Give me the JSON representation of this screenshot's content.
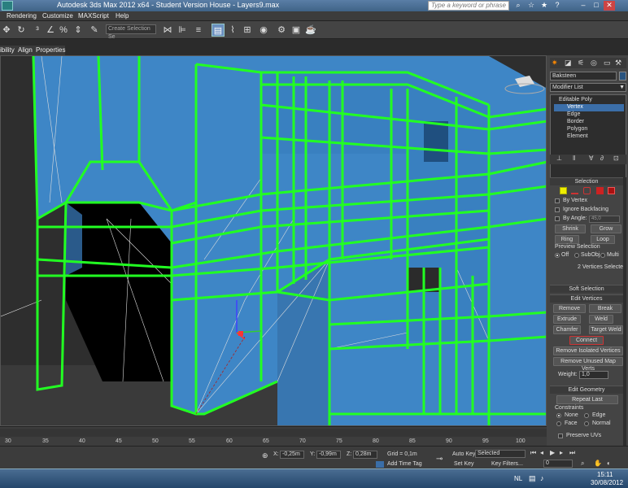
{
  "titlebar": {
    "title": "Autodesk 3ds Max 2012 x64 - Student Version House - Layers9.max",
    "search_placeholder": "Type a keyword or phrase"
  },
  "menu": [
    "Rendering",
    "Customize",
    "MAXScript",
    "Help"
  ],
  "toolbar": {
    "selection_set_placeholder": "Create Selection Se"
  },
  "ribbon": [
    "ibility",
    "Align",
    "Properties"
  ],
  "command_panel": {
    "object_name": "Baksteen",
    "modifier_list": "Modifier List",
    "stack": [
      "Editable Poly",
      "Vertex",
      "Edge",
      "Border",
      "Polygon",
      "Element"
    ],
    "selection": {
      "header": "Selection",
      "by_vertex": "By Vertex",
      "ignore_backfacing": "Ignore Backfacing",
      "by_angle": "By Angle:",
      "angle_value": "45,0",
      "shrink": "Shrink",
      "grow": "Grow",
      "ring": "Ring",
      "loop": "Loop",
      "preview_selection": "Preview Selection",
      "preview_off": "Off",
      "preview_subobj": "SubObj",
      "preview_multi": "Multi",
      "status": "2 Vertices Selected"
    },
    "soft_selection": "Soft Selection",
    "edit_vertices": {
      "header": "Edit Vertices",
      "remove": "Remove",
      "break": "Break",
      "extrude": "Extrude",
      "weld": "Weld",
      "chamfer": "Chamfer",
      "target_weld": "Target Weld",
      "connect": "Connect",
      "remove_isolated": "Remove Isolated Vertices",
      "remove_unused_map": "Remove Unused Map Verts",
      "weight_label": "Weight:",
      "weight_value": "1,0"
    },
    "edit_geometry": {
      "header": "Edit Geometry",
      "repeat_last": "Repeat Last",
      "constraints": "Constraints",
      "none": "None",
      "edge": "Edge",
      "face": "Face",
      "normal": "Normal",
      "preserve_uvs": "Preserve UVs"
    }
  },
  "timeline": {
    "ticks": [
      "30",
      "35",
      "40",
      "45",
      "50",
      "55",
      "60",
      "65",
      "70",
      "75",
      "80",
      "85",
      "90",
      "95",
      "100"
    ]
  },
  "statusbar": {
    "x_label": "X:",
    "x_value": "-0,25m",
    "y_label": "Y:",
    "y_value": "-0,99m",
    "z_label": "Z:",
    "z_value": "0,28m",
    "grid": "Grid = 0,1m",
    "add_time_tag": "Add Time Tag",
    "auto_key": "Auto Key",
    "selected": "Selected",
    "set_key": "Set Key",
    "key_filters": "Key Filters...",
    "frame": "0"
  },
  "taskbar": {
    "lang": "NL",
    "time": "15:11",
    "date": "30/08/2012"
  },
  "colors": {
    "wire_green": "#22ff22",
    "surface_blue": "#3e86c6",
    "selection_highlight": "#3b6ea8"
  }
}
